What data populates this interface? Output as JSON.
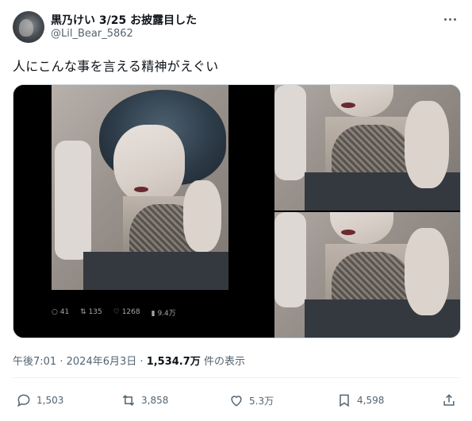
{
  "author": {
    "display_name": "黒乃けい 3/25 お披露目した",
    "handle": "@Lil_Bear_5862"
  },
  "tweet": {
    "text": "人にこんな事を言える精神がえぐい"
  },
  "embedded_post": {
    "replies": "41",
    "reposts": "135",
    "likes": "1268",
    "views": "9.4万"
  },
  "meta": {
    "time": "午後7:01",
    "separator1": "·",
    "date": "2024年6月3日",
    "separator2": "·",
    "views": "1,534.7万",
    "views_suffix": "件の表示"
  },
  "actions": {
    "reply_count": "1,503",
    "retweet_count": "3,858",
    "like_count": "5.3万",
    "bookmark_count": "4,598"
  },
  "icons": [
    "more-icon",
    "reply-icon",
    "retweet-icon",
    "like-icon",
    "bookmark-icon",
    "share-icon"
  ]
}
